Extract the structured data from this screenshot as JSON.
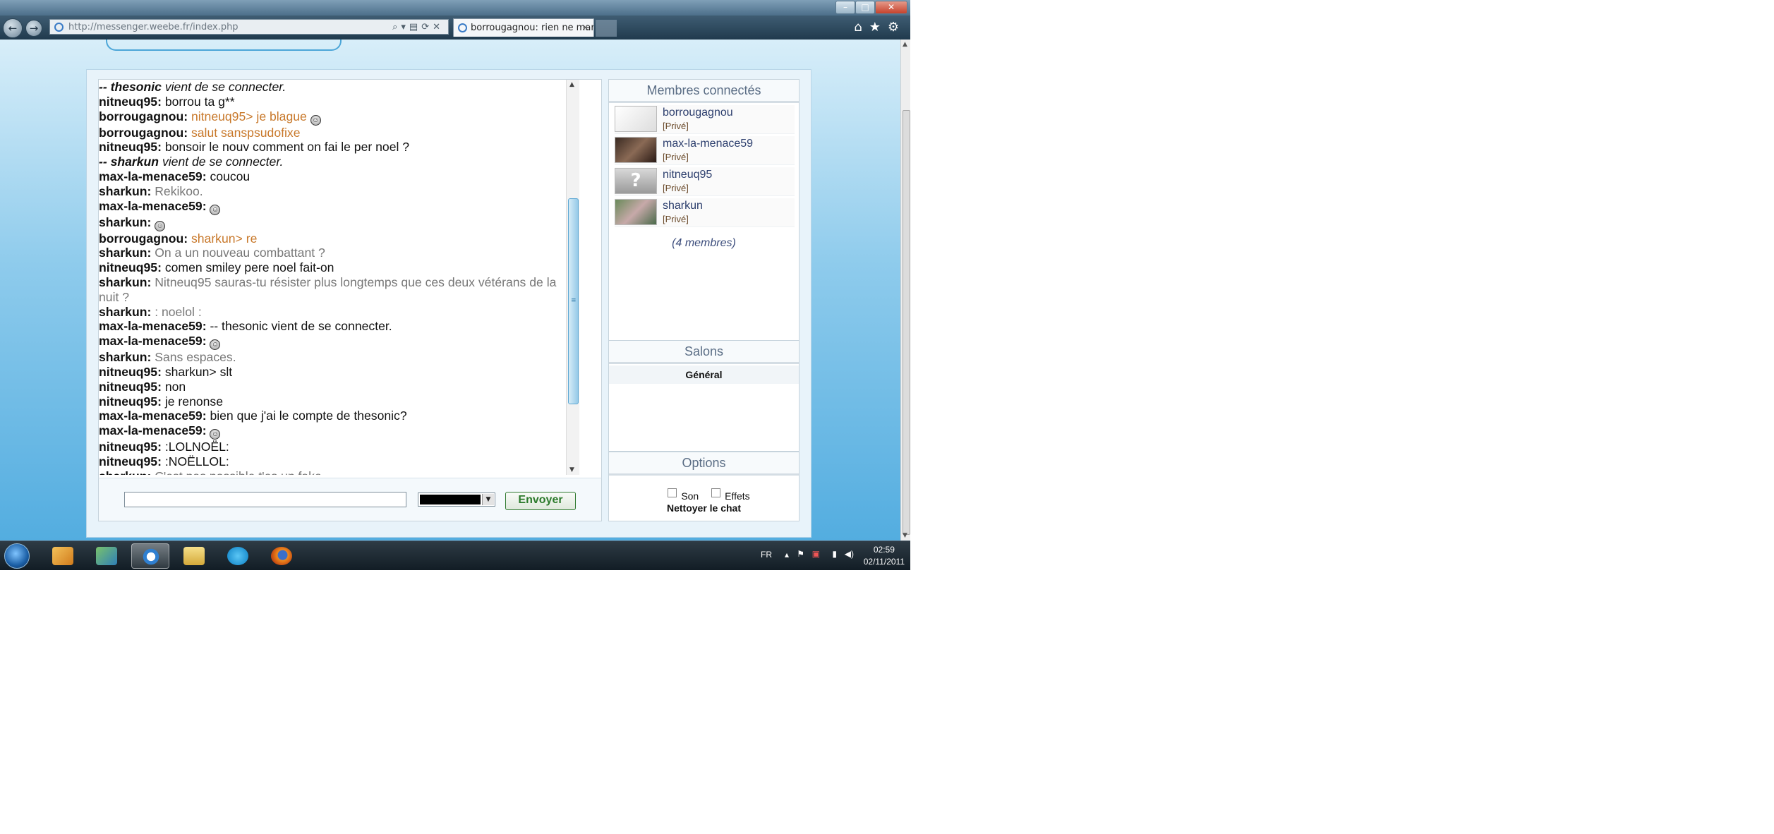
{
  "browser": {
    "address": "http://messenger.weebe.fr/index.php",
    "tab_title": "borrougagnou: rien ne mar...",
    "tab_close": "×"
  },
  "chat": {
    "messages": [
      {
        "user": "--",
        "text": "thesonic vient de se connecter.",
        "style": "sys",
        "bold_part": "thesonic"
      },
      {
        "user": "nitneuq95:",
        "text": "borrou ta g**",
        "style": "n"
      },
      {
        "user": "borrougagnou:",
        "text": "nitneuq95> je blague",
        "style": "o",
        "smiley": true
      },
      {
        "user": "borrougagnou:",
        "text": "salut sanspsudofixe",
        "style": "o"
      },
      {
        "user": "nitneuq95:",
        "text": "bonsoir le nouv comment on fai le per noel ?",
        "style": "n"
      },
      {
        "user": "--",
        "text": "sharkun vient de se connecter.",
        "style": "sys",
        "bold_part": "sharkun"
      },
      {
        "user": "max-la-menace59:",
        "text": "coucou",
        "style": "n"
      },
      {
        "user": "sharkun:",
        "text": "Rekikoo.",
        "style": "g"
      },
      {
        "user": "max-la-menace59:",
        "text": "",
        "style": "n",
        "smiley": true
      },
      {
        "user": "sharkun:",
        "text": "",
        "style": "g",
        "smiley": true
      },
      {
        "user": "borrougagnou:",
        "text": "sharkun> re",
        "style": "o"
      },
      {
        "user": "sharkun:",
        "text": "On a un nouveau combattant ?",
        "style": "g"
      },
      {
        "user": "nitneuq95:",
        "text": "comen smiley pere noel fait-on",
        "style": "n"
      },
      {
        "user": "sharkun:",
        "text": "Nitneuq95 sauras-tu résister plus longtemps que ces deux vétérans de la nuit ?",
        "style": "g"
      },
      {
        "user": "sharkun:",
        "text": ": noelol :",
        "style": "g"
      },
      {
        "user": "max-la-menace59:",
        "text": "-- thesonic vient de se connecter.",
        "style": "n"
      },
      {
        "user": "max-la-menace59:",
        "text": "",
        "style": "n",
        "smiley": true
      },
      {
        "user": "sharkun:",
        "text": "Sans espaces.",
        "style": "g"
      },
      {
        "user": "nitneuq95:",
        "text": "sharkun> slt",
        "style": "n"
      },
      {
        "user": "nitneuq95:",
        "text": "non",
        "style": "n"
      },
      {
        "user": "nitneuq95:",
        "text": "je renonse",
        "style": "n"
      },
      {
        "user": "max-la-menace59:",
        "text": "bien que j'ai le compte de thesonic?",
        "style": "n"
      },
      {
        "user": "max-la-menace59:",
        "text": "",
        "style": "n",
        "smiley": true
      },
      {
        "user": "nitneuq95:",
        "text": ":LOLNOËL:",
        "style": "n"
      },
      {
        "user": "nitneuq95:",
        "text": ":NOËLLOL:",
        "style": "n"
      },
      {
        "user": "sharkun:",
        "text": "C'est pas possible t'es un fake.",
        "style": "g"
      }
    ],
    "input_value": "",
    "send_label": "Envoyer",
    "text_color": "#000000"
  },
  "members": {
    "title": "Membres connectés",
    "list": [
      {
        "name": "borrougagnou",
        "status": "[Privé]"
      },
      {
        "name": "max-la-menace59",
        "status": "[Privé]"
      },
      {
        "name": "nitneuq95",
        "status": "[Privé]"
      },
      {
        "name": "sharkun",
        "status": "[Privé]"
      }
    ],
    "count": "(4 membres)"
  },
  "salons": {
    "title": "Salons",
    "items": [
      "Général"
    ]
  },
  "options": {
    "title": "Options",
    "sound_label": "Son",
    "effects_label": "Effets",
    "clear_label": "Nettoyer le chat"
  },
  "taskbar": {
    "language": "FR",
    "time": "02:59",
    "date": "02/11/2011"
  },
  "colors": {
    "orange_msg": "#c8782a",
    "grey_msg": "#777777",
    "send_green": "#2b7a2b",
    "panel_title": "#5a6d85"
  }
}
